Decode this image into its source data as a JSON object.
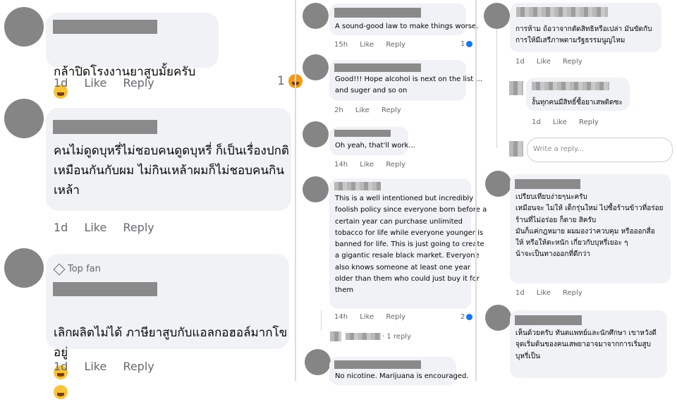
{
  "panel1": {
    "comments": [
      {
        "text": "กล้าปิดโรงงานยาสูบมั้ยครับ",
        "time": "1d",
        "like": "Like",
        "reply": "Reply",
        "reaction_count": "1"
      },
      {
        "text": "คนไม่ดูดบุหรี่ไม่ชอบคนดูดบุหรี่ ก็เป็นเรื่องปกติ\nเหมือนกันกับผม ไม่กินเหล้าผมก็ไม่ชอบคนกิน\nเหล้า",
        "time": "1d",
        "like": "Like",
        "reply": "Reply"
      },
      {
        "badge": "Top fan",
        "text": "เลิกผลิตไม่ได้ ภาษียาสูบกับแอลกอฮอล์มากโข\nอยู่",
        "time": "1d",
        "like": "Like",
        "reply": "Reply"
      }
    ]
  },
  "panel2": {
    "comments": [
      {
        "text": "A sound-good law to make things worse.",
        "time": "15h",
        "like": "Like",
        "reply": "Reply",
        "reaction_count": "1"
      },
      {
        "text": "Good!!! Hope alcohol is next on the list ...\nand suger and so on",
        "time": "2h",
        "like": "Like",
        "reply": "Reply"
      },
      {
        "text": "Oh yeah, that'll work...",
        "time": "14h",
        "like": "Like",
        "reply": "Reply"
      },
      {
        "text": "This is a well intentioned but incredibly\nfoolish policy since everyone born before a\ncertain year can purchase unlimited\ntobacco for life while everyone younger is\nbanned for life. This is just going to create\na gigantic resale black market. Everyone\nalso knows someone at least one year\nolder than them who could just buy it for\nthem",
        "time": "14h",
        "like": "Like",
        "reply": "Reply",
        "reaction_count": "2",
        "replies_link": "· 1 reply"
      },
      {
        "text": "No nicotine. Marijuana is encouraged."
      }
    ]
  },
  "panel3": {
    "comments": [
      {
        "text": "การห้าม ถ้อวาจากตัดสิทธิหรือเปล่า มันขัดกับ\nการให้มีเสรีภาพตามรัฐธรรมนูญไหม",
        "time": "1d",
        "like": "Like",
        "reply": "Reply"
      },
      {
        "text": "งั้นทุกคนมีสิทธิ์ซื้อยาเสพติดซะ",
        "time": "1d",
        "like": "Like",
        "reply": "Reply"
      },
      {
        "text": "เปรียบเทียบง่ายๆนะครับ\nเหมือนจะ ไม่ให้ เด็กรุ่นใหม่ ไปซื้อร้านข้าวที่อร่อย\nร้านที่ไม่อร่อย ก็ตาย สิครับ\nมันก็แค่กฎหมาย ผมมองว่าควบคุม หรือออกสื่อ\nให้ หรือให้ตะหนัก เกี่ยวกับบุหรี่เยอะ ๆ\nน้าจะเป็นทางออกที่ดีกว่า",
        "time": "1d",
        "like": "Like",
        "reply": "Reply"
      },
      {
        "text": "เห็นด้วยครับ ทันตแพทย์และนักศึกษา เขาหวังดี\nจุดเริ่มต้นของคนเสพยาอาจมาจากการเริ่มสูบ\nบุหรี่เป็น"
      }
    ],
    "reply_box": {
      "placeholder": "Write a reply..."
    }
  },
  "colors": {
    "bubble": "#f0f2f5",
    "meta": "#65676b",
    "like_blue": "#1877f2",
    "emoji": "#f7c33a"
  }
}
